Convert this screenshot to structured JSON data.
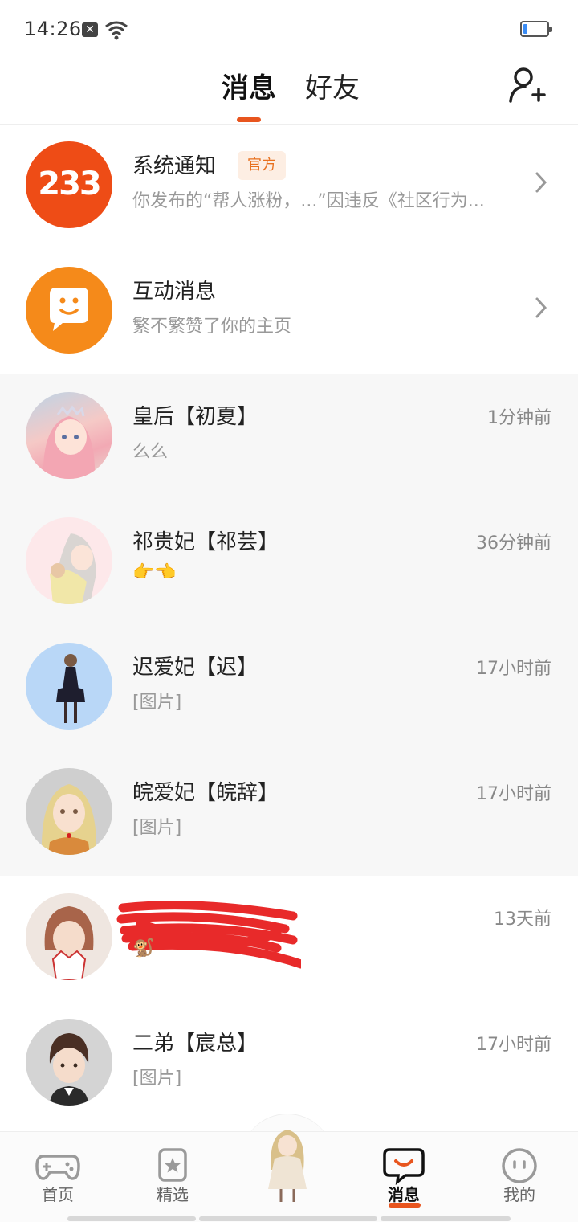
{
  "status_bar": {
    "time": "14:26"
  },
  "header": {
    "tabs": [
      {
        "label": "消息",
        "active": true
      },
      {
        "label": "好友",
        "active": false
      }
    ]
  },
  "system_notice": {
    "name": "系统通知",
    "badge": "官方",
    "preview": "你发布的“帮人涨粉，...”因违反《社区行为...",
    "avatar_text": "233"
  },
  "interaction": {
    "name": "互动消息",
    "preview": "繁不繁赞了你的主页"
  },
  "conversations": [
    {
      "name": "皇后【初夏】",
      "preview": "么么",
      "time": "1分钟前"
    },
    {
      "name": "祁贵妃【祁芸】",
      "preview": "👉👈",
      "time": "36分钟前"
    },
    {
      "name": "迟爱妃【迟】",
      "preview": "[图片]",
      "time": "17小时前"
    },
    {
      "name": "皖爱妃【皖辞】",
      "preview": "[图片]",
      "time": "17小时前"
    },
    {
      "name": "",
      "preview": "🐒",
      "time": "13天前"
    },
    {
      "name": "二弟【宸总】",
      "preview": "[图片]",
      "time": "17小时前"
    }
  ],
  "bottom_nav": [
    {
      "label": "首页",
      "icon": "gamepad-icon"
    },
    {
      "label": "精选",
      "icon": "star-badge-icon"
    },
    {
      "label": "",
      "icon": "character-avatar-icon"
    },
    {
      "label": "消息",
      "icon": "chat-bubble-icon",
      "active": true
    },
    {
      "label": "我的",
      "icon": "face-icon"
    }
  ],
  "colors": {
    "accent": "#e8551e",
    "badge_bg": "#fdeee3",
    "redaction": "#e82a2a"
  }
}
